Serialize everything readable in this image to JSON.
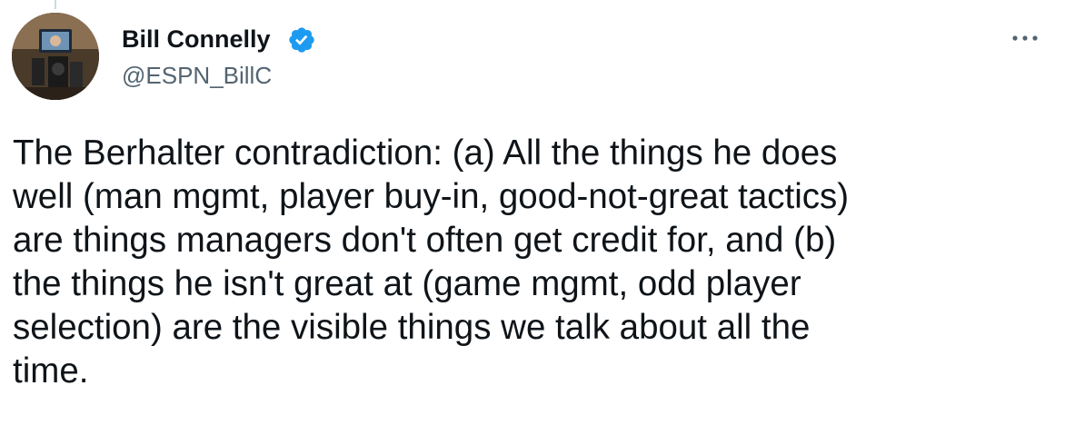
{
  "author": {
    "name": "Bill Connelly",
    "handle": "@ESPN_BillC",
    "verified": true,
    "avatar_icon": "profile-photo"
  },
  "more_icon": "ellipsis-icon",
  "tweet": {
    "text": "The Berhalter contradiction: (a) All the things he does\nwell (man mgmt, player buy-in, good-not-great tactics)\nare things managers don't often get credit for, and (b)\nthe things he isn't great at (game mgmt, odd player\nselection) are the visible things we talk about all the\ntime."
  },
  "colors": {
    "text": "#0f1419",
    "secondary": "#536471",
    "verified_badge": "#1d9bf0"
  }
}
